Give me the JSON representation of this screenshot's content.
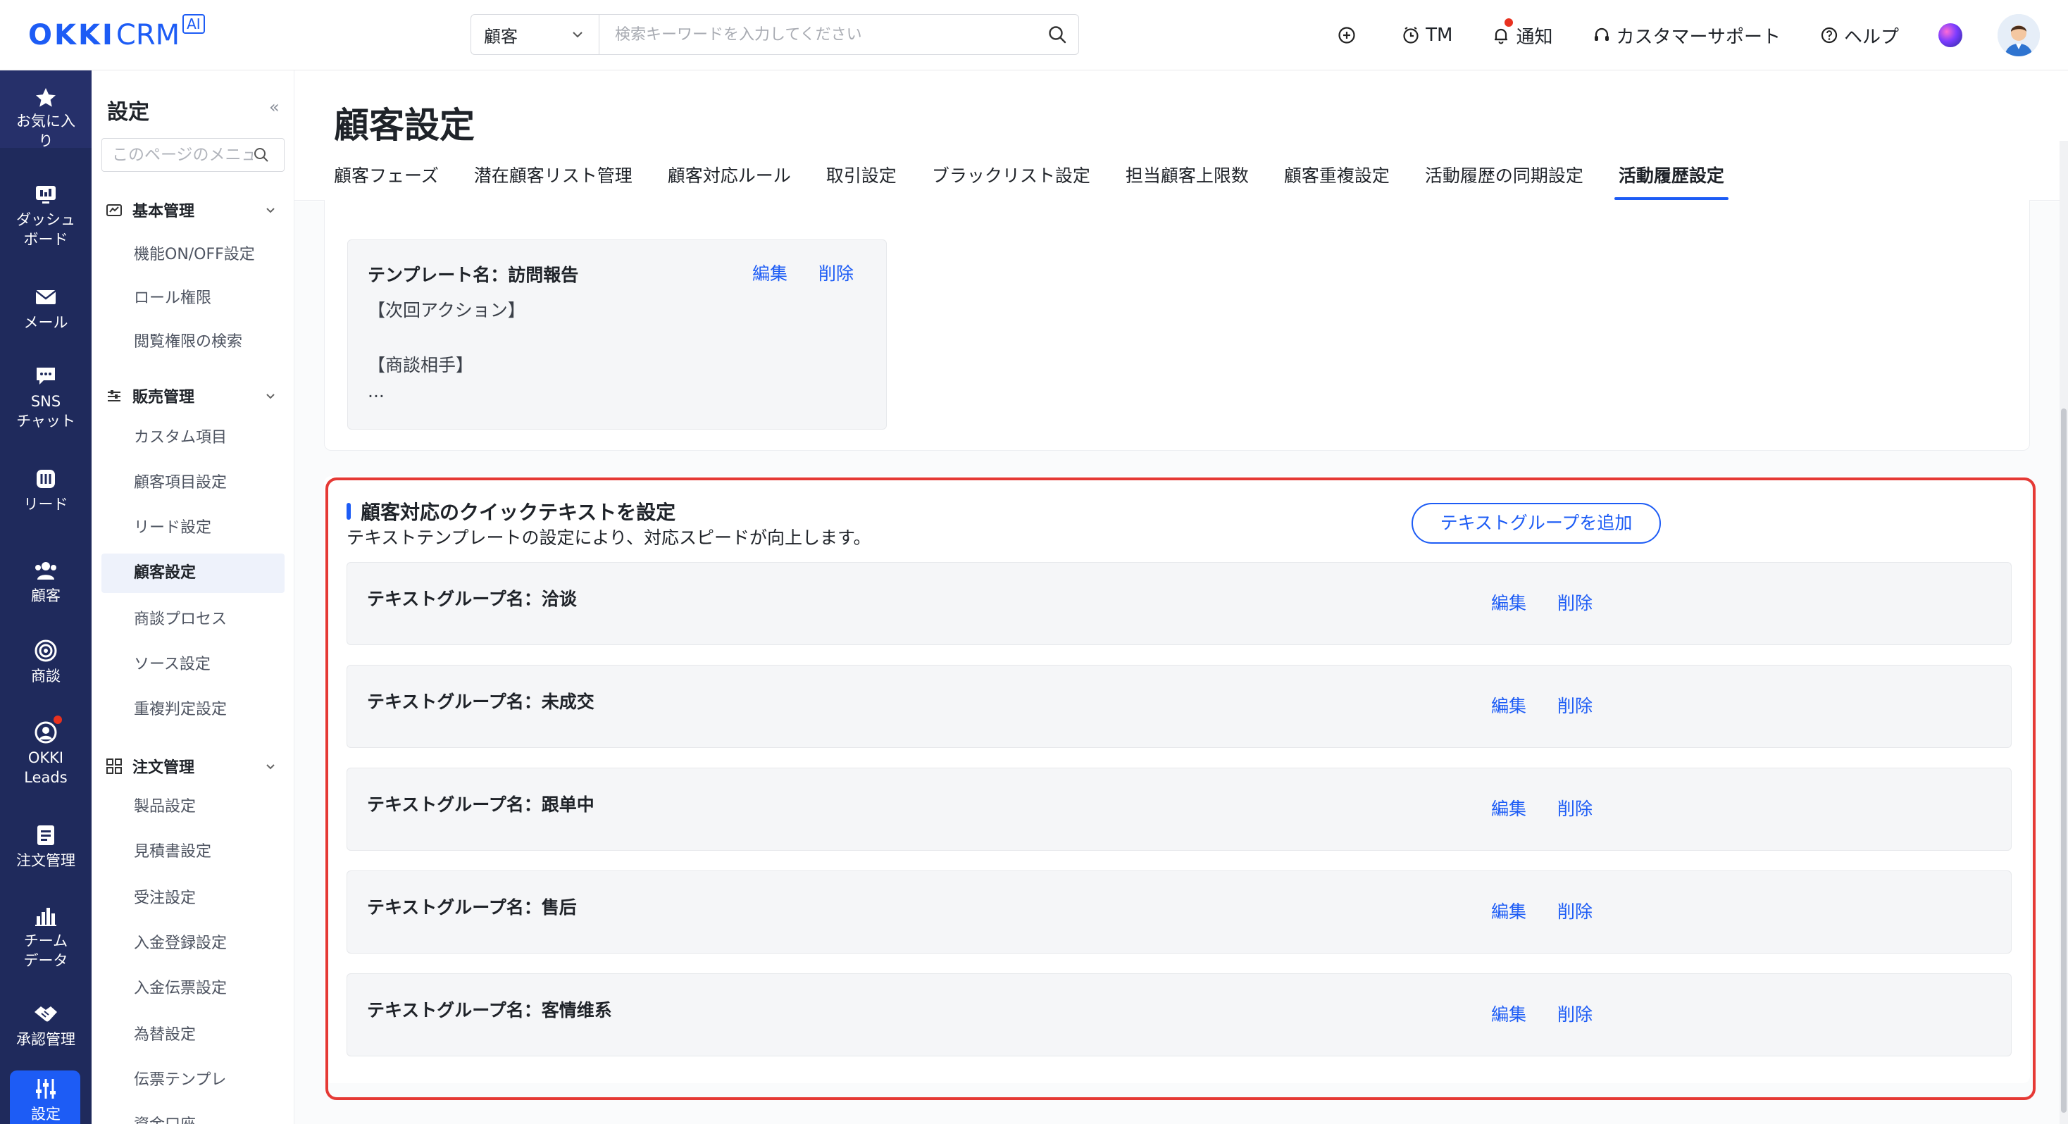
{
  "header": {
    "logo_main": "OKKI",
    "logo_crm": "CRM",
    "logo_badge": "AI",
    "search_scope": "顧客",
    "search_placeholder": "検索キーワードを入力してください",
    "tm": "TM",
    "notify": "通知",
    "support": "カスタマーサポート",
    "help": "ヘルプ"
  },
  "rail": [
    {
      "label": "お気に入り",
      "icon": "star-icon"
    },
    {
      "label": "ダッシュボード",
      "icon": "dashboard-icon"
    },
    {
      "label": "メール",
      "icon": "mail-icon"
    },
    {
      "label": "SNSチャット",
      "icon": "chat-icon"
    },
    {
      "label": "リード",
      "icon": "lead-icon"
    },
    {
      "label": "顧客",
      "icon": "customers-icon"
    },
    {
      "label": "商談",
      "icon": "target-icon"
    },
    {
      "label": "OKKI Leads",
      "icon": "okki-leads-icon"
    },
    {
      "label": "注文管理",
      "icon": "order-icon"
    },
    {
      "label": "チームデータ",
      "icon": "bar-chart-icon"
    },
    {
      "label": "承認管理",
      "icon": "handshake-icon"
    },
    {
      "label": "設定",
      "icon": "settings-sliders-icon"
    }
  ],
  "rail_lines": {
    "fav": [
      "お気に入",
      "り"
    ],
    "dash": [
      "ダッシュ",
      "ボード"
    ],
    "mail": [
      "メール"
    ],
    "sns": [
      "SNS",
      "チャット"
    ],
    "lead": [
      "リード"
    ],
    "cust": [
      "顧客"
    ],
    "deal": [
      "商談"
    ],
    "okki": [
      "OKKI",
      "Leads"
    ],
    "order": [
      "注文管理"
    ],
    "team": [
      "チーム",
      "データ"
    ],
    "approve": [
      "承認管理"
    ],
    "settings": [
      "設定"
    ]
  },
  "sub": {
    "title": "設定",
    "search_placeholder": "このページのメニュー",
    "groups": [
      {
        "label": "基本管理",
        "items": [
          "機能ON/OFF設定",
          "ロール権限",
          "閲覧権限の検索"
        ]
      },
      {
        "label": "販売管理",
        "items": [
          "カスタム項目",
          "顧客項目設定",
          "リード設定",
          "顧客設定",
          "商談プロセス",
          "ソース設定",
          "重複判定設定"
        ]
      },
      {
        "label": "注文管理",
        "items": [
          "製品設定",
          "見積書設定",
          "受注設定",
          "入金登録設定",
          "入金伝票設定",
          "為替設定",
          "伝票テンプレ",
          "資金口座"
        ]
      }
    ],
    "active_item": "顧客設定"
  },
  "main": {
    "title": "顧客設定",
    "tabs": [
      "顧客フェーズ",
      "潜在顧客リスト管理",
      "顧客対応ルール",
      "取引設定",
      "ブラックリスト設定",
      "担当顧客上限数",
      "顧客重複設定",
      "活動履歴の同期設定",
      "活動履歴設定"
    ],
    "active_tab": "活動履歴設定",
    "template": {
      "name": "テンプレート名：訪問報告",
      "edit": "編集",
      "delete": "削除",
      "lines": [
        "【次回アクション】",
        "",
        "【商談相手】",
        "..."
      ]
    },
    "quick": {
      "title": "顧客対応のクイックテキストを設定",
      "desc": "テキストテンプレートの設定により、対応スピードが向上します。",
      "add_button": "テキストグループを追加",
      "groups": [
        {
          "name": "テキストグループ名：洽谈",
          "edit": "編集",
          "delete": "削除"
        },
        {
          "name": "テキストグループ名：未成交",
          "edit": "編集",
          "delete": "削除"
        },
        {
          "name": "テキストグループ名：跟单中",
          "edit": "編集",
          "delete": "削除"
        },
        {
          "name": "テキストグループ名：售后",
          "edit": "編集",
          "delete": "削除"
        },
        {
          "name": "テキストグループ名：客情维系",
          "edit": "編集",
          "delete": "削除"
        }
      ]
    }
  },
  "colors": {
    "accent": "#1d5cf5",
    "rail_bg": "#1f2a5c",
    "highlight": "#e53935",
    "badge": "#e8311f"
  }
}
